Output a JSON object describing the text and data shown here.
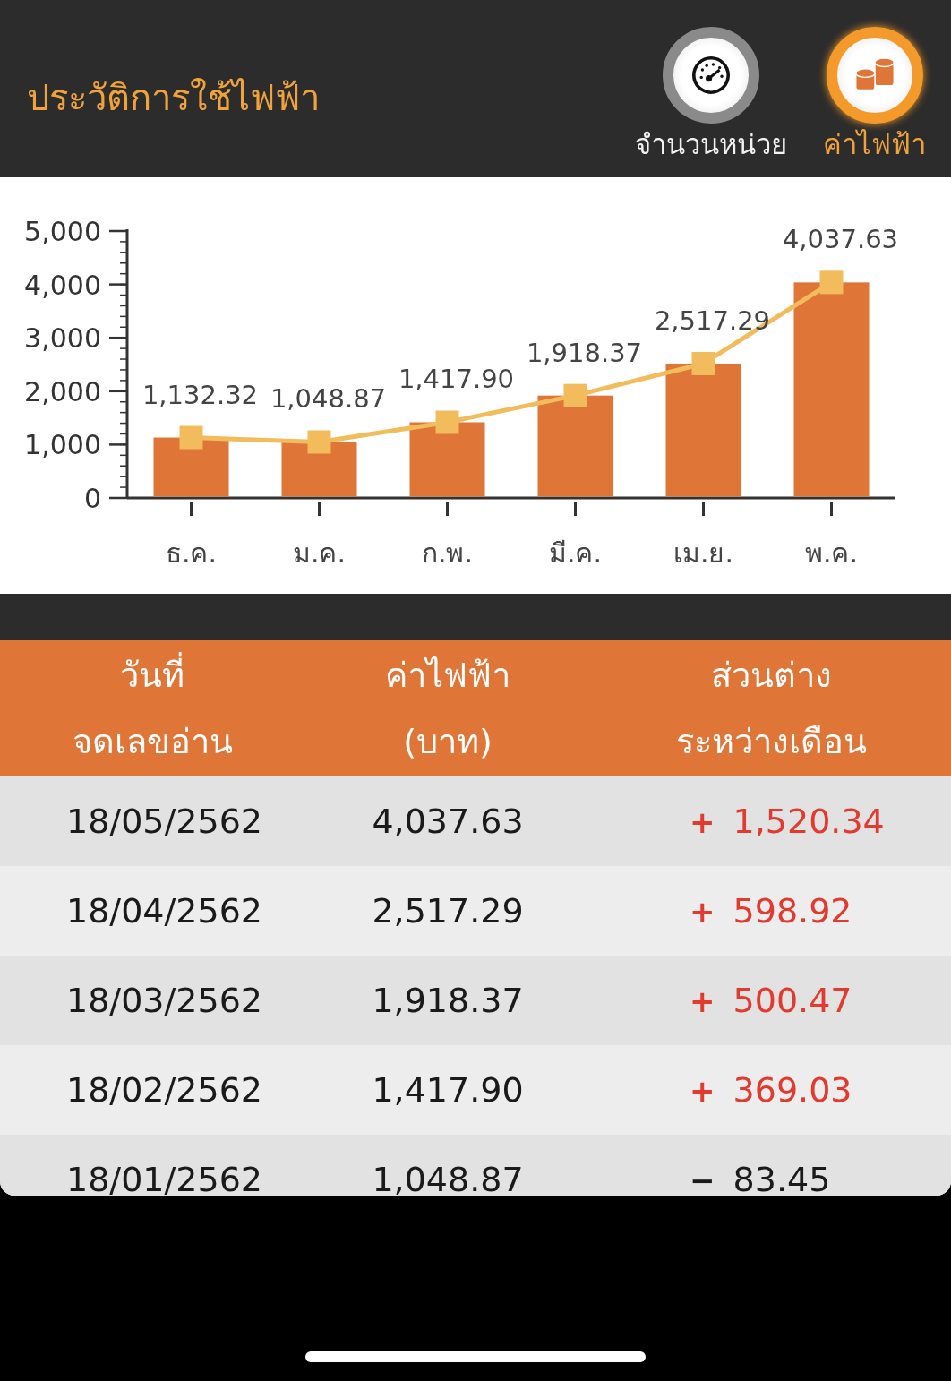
{
  "header": {
    "title": "ประวัติการใช้ไฟฟ้า"
  },
  "tabs": [
    {
      "label": "จำนวนหน่วย",
      "kind": "gauge",
      "selected": false
    },
    {
      "label": "ค่าไฟฟ้า",
      "kind": "coins",
      "selected": true
    }
  ],
  "chart": {
    "chart_data": {
      "type": "bar",
      "categories": [
        "ธ.ค.",
        "ม.ค.",
        "ก.พ.",
        "มี.ค.",
        "เม.ย.",
        "พ.ค."
      ],
      "series": [
        {
          "color": "#e07538",
          "values": [
            1132.32,
            1048.87,
            1417.9,
            1918.37,
            2517.29,
            4037.63
          ]
        },
        {
          "type": "line",
          "marker": "square",
          "color": "#f2bc5c",
          "values": [
            1132.32,
            1048.87,
            1417.9,
            1918.37,
            2517.29,
            4037.63
          ]
        }
      ],
      "ylim": [
        0,
        5000
      ],
      "yticks": [
        {
          "value": 0,
          "label": "0"
        },
        {
          "value": 1000,
          "label": "1,000"
        },
        {
          "value": 2000,
          "label": "2,000"
        },
        {
          "value": 3000,
          "label": "3,000"
        },
        {
          "value": 4000,
          "label": "4,000"
        },
        {
          "value": 5000,
          "label": "5,000"
        }
      ],
      "value_labels": [
        "1,132.32",
        "1,048.87",
        "1,417.90",
        "1,918.37",
        "2,517.29",
        "4,037.63"
      ]
    }
  },
  "table": {
    "columns": [
      [
        "วันที่",
        "จดเลขอ่าน"
      ],
      [
        "ค่าไฟฟ้า",
        "(บาท)"
      ],
      [
        "ส่วนต่าง",
        "ระหว่างเดือน"
      ]
    ],
    "rows": [
      {
        "date": "18/05/2562",
        "amount": "4,037.63",
        "sign": "+",
        "difference": "1,520.34",
        "kind": "increase"
      },
      {
        "date": "18/04/2562",
        "amount": "2,517.29",
        "sign": "+",
        "difference": "598.92",
        "kind": "increase"
      },
      {
        "date": "18/03/2562",
        "amount": "1,918.37",
        "sign": "+",
        "difference": "500.47",
        "kind": "increase"
      },
      {
        "date": "18/02/2562",
        "amount": "1,417.90",
        "sign": "+",
        "difference": "369.03",
        "kind": "increase"
      },
      {
        "date": "18/01/2562",
        "amount": "1,048.87",
        "sign": "−",
        "difference": "83.45",
        "kind": "decrease"
      }
    ]
  }
}
